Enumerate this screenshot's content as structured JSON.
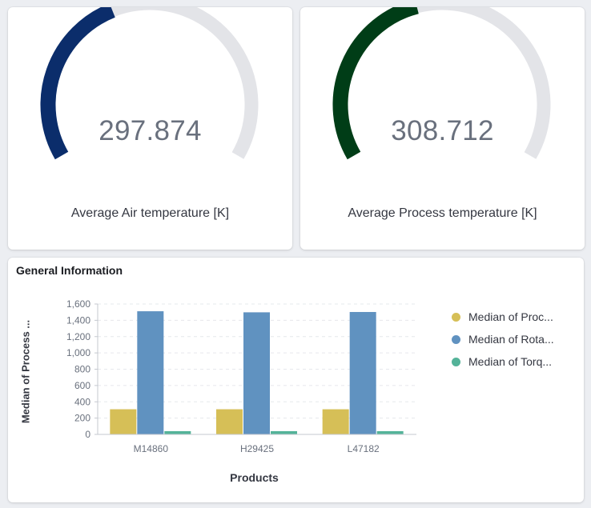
{
  "gauges": [
    {
      "value": "297.874",
      "label": "Average Air temperature [K]",
      "fill_fraction": 0.41,
      "color": "#0b2d6b",
      "track_color": "#e3e4e8"
    },
    {
      "value": "308.712",
      "label": "Average Process temperature [K]",
      "fill_fraction": 0.44,
      "color": "#003d17",
      "track_color": "#e3e4e8"
    }
  ],
  "chart_panel": {
    "title": "General Information",
    "legend": [
      {
        "label": "Median of Proc...",
        "color": "#d6bf57"
      },
      {
        "label": "Median of Rota...",
        "color": "#6092c0"
      },
      {
        "label": "Median of Torq...",
        "color": "#54b399"
      }
    ]
  },
  "chart_data": {
    "type": "bar",
    "categories": [
      "M14860",
      "H29425",
      "L47182"
    ],
    "series": [
      {
        "name": "Median of Proc...",
        "values": [
          308.6,
          308.7,
          308.5
        ],
        "color": "#d6bf57"
      },
      {
        "name": "Median of Rota...",
        "values": [
          1511,
          1498,
          1502
        ],
        "color": "#6092c0"
      },
      {
        "name": "Median of Torq...",
        "values": [
          40,
          40,
          40
        ],
        "color": "#54b399"
      }
    ],
    "xlabel": "Products",
    "ylabel": "Median of Process ...",
    "ylim": [
      0,
      1600
    ],
    "yticks": [
      0,
      200,
      400,
      600,
      800,
      1000,
      1200,
      1400,
      1600
    ],
    "ytick_labels": [
      "0",
      "200",
      "400",
      "600",
      "800",
      "1,000",
      "1,200",
      "1,400",
      "1,600"
    ],
    "grid": true,
    "legend_position": "right"
  }
}
